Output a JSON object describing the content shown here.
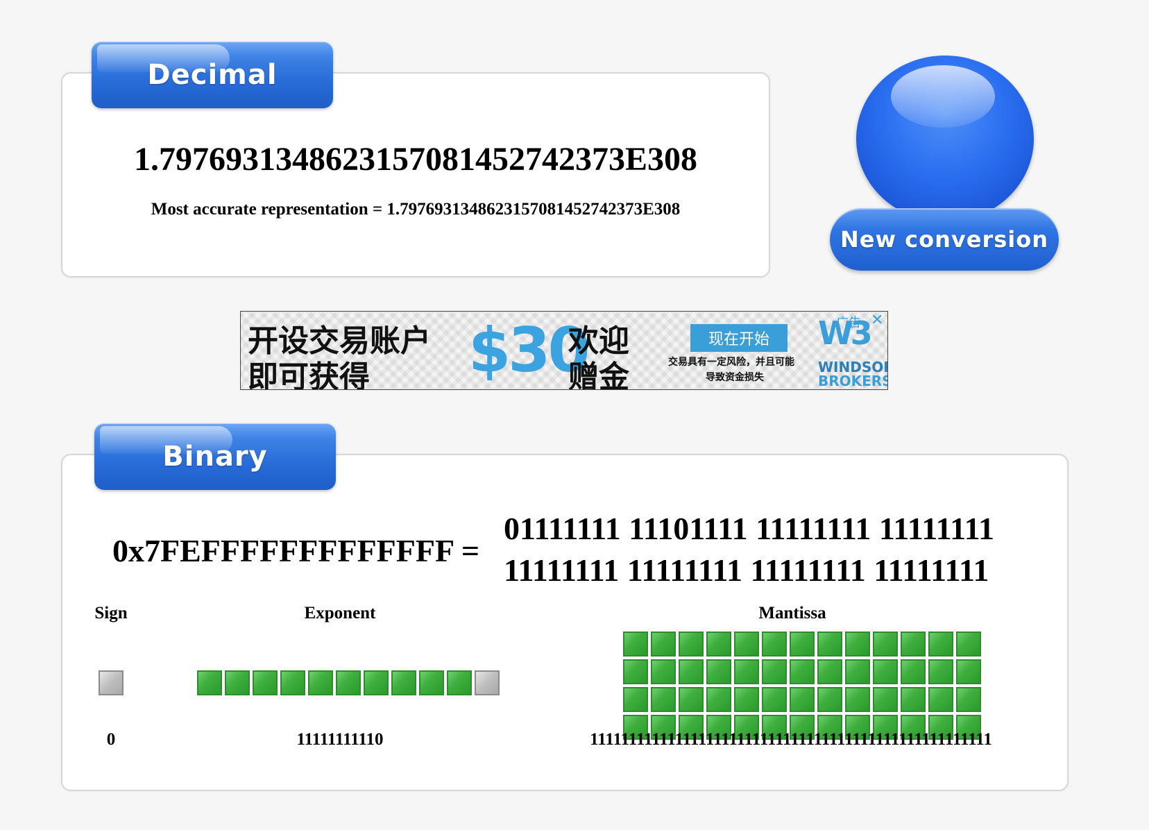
{
  "decimal": {
    "tab_label": "Decimal",
    "value": "1.7976931348623157081452742373E308",
    "accurate_text": "Most accurate representation = 1.7976931348623157081452742373E308"
  },
  "new_conversion": {
    "label": "New conversion"
  },
  "ad": {
    "line1": "开设交易账户",
    "line2": "即可获得",
    "amount": "$30",
    "welcome1": "欢迎",
    "welcome2": "赠金",
    "cta": "现在开始",
    "risk1": "交易具有一定风险，并且可能",
    "risk2": "导致资金损失",
    "brand1": "WINDSOR",
    "brand2": "BROKERS",
    "tag": "广告",
    "close": "✕"
  },
  "binary": {
    "tab_label": "Binary",
    "hex_eq": "0x7FEFFFFFFFFFFFFF =",
    "bits_line1": "01111111 11101111 11111111 11111111",
    "bits_line2": "11111111 11111111 11111111 11111111",
    "sign": {
      "label": "Sign",
      "bits": "0"
    },
    "exponent": {
      "label": "Exponent",
      "bits": "11111111110"
    },
    "mantissa": {
      "label": "Mantissa",
      "bits": "1111111111111111111111111111111111111111111111111111"
    }
  },
  "colors": {
    "bit_on": "#3fb03f",
    "bit_off": "#bdbdbd",
    "tab_blue": "#2a6ed9"
  }
}
